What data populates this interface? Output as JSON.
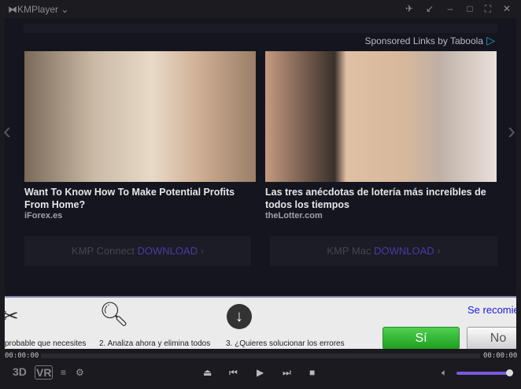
{
  "window": {
    "title": "KMPlayer",
    "controls": [
      "pin",
      "mini",
      "minimize",
      "maximize",
      "fullscreen",
      "close"
    ]
  },
  "sponsor": {
    "text": "Sponsored Links by Taboola"
  },
  "ads": [
    {
      "title": "Want To Know How To Make Potential Profits From Home?",
      "source": "iForex.es"
    },
    {
      "title": "Las tres anécdotas de lotería más increíbles de todos los tiempos",
      "source": "theLotter.com"
    }
  ],
  "downloads": [
    {
      "label": "KMP Connect",
      "action": "DOWNLOAD"
    },
    {
      "label": "KMP Mac",
      "action": "DOWNLOAD"
    }
  ],
  "banner": {
    "steps": [
      "probable que necesites",
      "2. Analiza ahora y elimina todos",
      "3. ¿Quieres solucionar los errores"
    ],
    "recommend": "Se recomie",
    "yes": "Sí",
    "no": "No"
  },
  "player": {
    "time_current": "00:00:00",
    "time_total": "00:00:00",
    "btn_3d": "3D",
    "btn_vr": "VR",
    "volume": 0.95,
    "progress": 0
  }
}
